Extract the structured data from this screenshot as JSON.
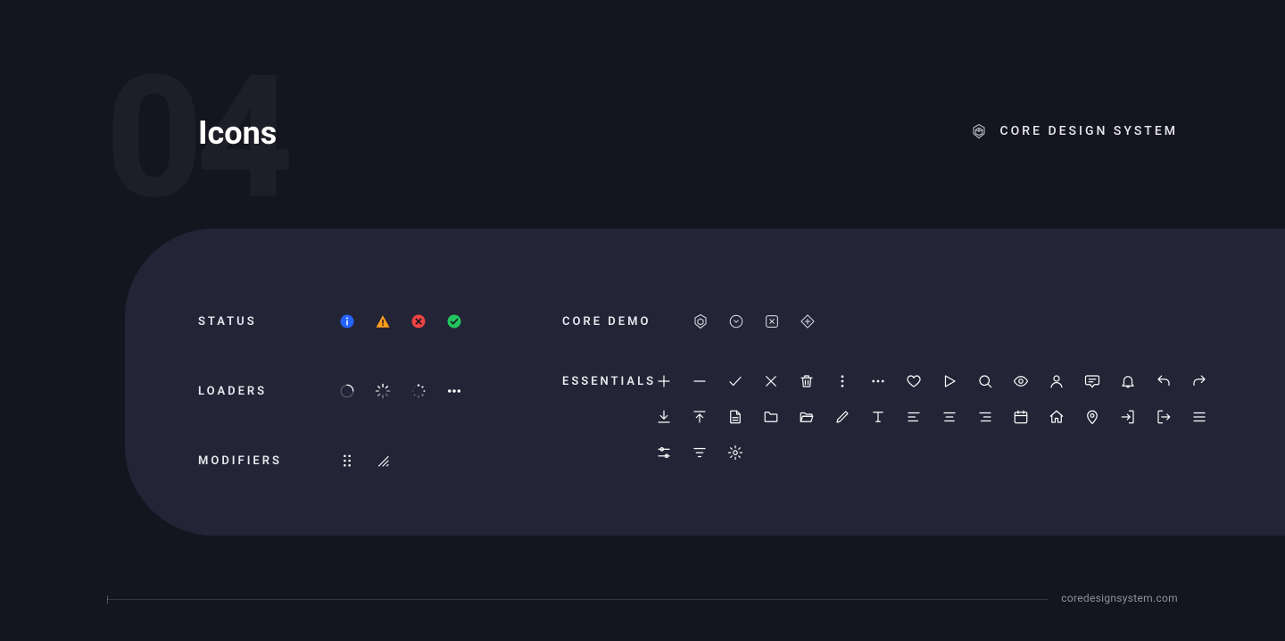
{
  "page": {
    "number": "04",
    "title": "Icons",
    "brand": "CORE DESIGN SYSTEM",
    "footer_url": "coredesignsystem.com"
  },
  "sections": {
    "status": "STATUS",
    "loaders": "LOADERS",
    "modifiers": "MODIFIERS",
    "core_demo": "CORE DEMO",
    "essentials": "ESSENTIALS"
  },
  "colors": {
    "info": "#2563ff",
    "warning": "#ff9f1a",
    "error": "#ef4444",
    "success": "#22c55e",
    "icon": "#ffffff",
    "panel": "#232436",
    "bg": "#14151f"
  },
  "icons": {
    "status": [
      "info-circle",
      "warning-triangle",
      "error-circle",
      "success-circle"
    ],
    "loaders": [
      "spinner-ring",
      "spinner-dashes",
      "spinner-dots-circle",
      "dots-horizontal"
    ],
    "modifiers": [
      "drag-handle",
      "resize-corner"
    ],
    "core_demo": [
      "hexagon-cube",
      "circle-chevron",
      "square-x",
      "diamond-plus"
    ],
    "essentials": [
      "plus",
      "minus",
      "check",
      "close",
      "trash",
      "more-vertical",
      "more-horizontal",
      "heart",
      "play",
      "search",
      "eye",
      "user",
      "chat",
      "bell",
      "reply",
      "forward",
      "download",
      "upload",
      "document",
      "folder",
      "folder-open",
      "edit",
      "text",
      "align-left",
      "align-center",
      "align-right",
      "calendar",
      "home",
      "location-pin",
      "log-in",
      "log-out",
      "menu",
      "sliders",
      "filter",
      "settings-gear"
    ]
  }
}
